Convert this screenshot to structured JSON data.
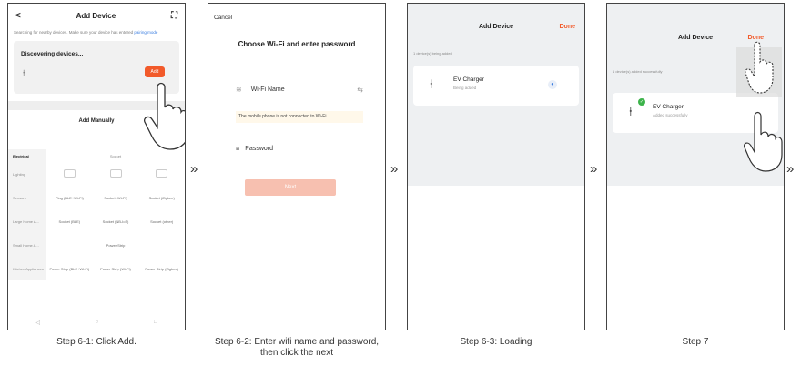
{
  "step1": {
    "title": "Add Device",
    "back_icon": "<",
    "scan_icon": "⛶",
    "notice": "Searching for nearby devices. Make sure your device has entered",
    "notice_link": "pairing mode",
    "discovering": "Discovering devices...",
    "add_label": "Add",
    "manual_label": "Add Manually",
    "grid_header": [
      "Electrical",
      "Socket"
    ],
    "categories": [
      "Lighting",
      "Sensors",
      "Large Home A...",
      "Small Home A...",
      "Kitchen Appliances"
    ],
    "grid_rows": [
      [
        "",
        "",
        ""
      ],
      [
        "Plug (BLE+Wi-Fi)",
        "Socket (Wi-Fi)",
        "Socket (Zigbee)"
      ],
      [
        "Socket (BLE)",
        "Socket (NB-IoT)",
        "Socket (other)"
      ],
      [
        "",
        "Power Strip",
        ""
      ],
      [
        "Power Strip (BLE+Wi-Fi)",
        "Power Strip (Wi-Fi)",
        "Power Strip (Zigbee)"
      ]
    ],
    "nav": [
      "◁",
      "○",
      "□"
    ]
  },
  "step2": {
    "cancel": "Cancel",
    "heading": "Choose Wi-Fi and enter password",
    "wifi_placeholder": "Wi-Fi Name",
    "warning": "The mobile phone is not connected to Wi-Fi.",
    "password_placeholder": "Password",
    "next_label": "Next"
  },
  "step3": {
    "title": "Add Device",
    "done": "Done",
    "sub": "1 device(s) being added",
    "device_name": "EV Charger",
    "device_state": "Being added"
  },
  "step4": {
    "title": "Add Device",
    "done": "Done",
    "sub": "1 device(s) added successfully",
    "device_name": "EV Charger",
    "device_state": "Added successfully"
  },
  "captions": {
    "c1": "Step 6-1: Click Add.",
    "c2": "Step 6-2: Enter wifi name and password, then click the next",
    "c3": "Step 6-3: Loading",
    "c4": "Step 7"
  },
  "arrow": "»"
}
